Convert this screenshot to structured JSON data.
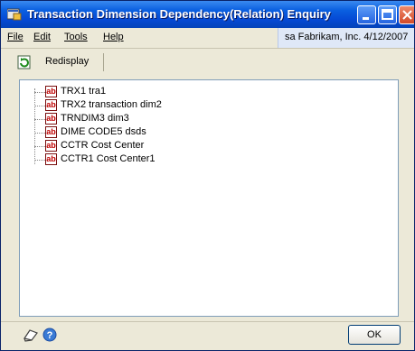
{
  "window": {
    "title": "Transaction Dimension Dependency(Relation) Enquiry"
  },
  "menu": {
    "file": "File",
    "edit": "Edit",
    "tools": "Tools",
    "help": "Help"
  },
  "context": {
    "text": "sa  Fabrikam, Inc.  4/12/2007"
  },
  "toolbar": {
    "redisplay_label": "Redisplay"
  },
  "tree": {
    "items": [
      {
        "code": "TRX1",
        "desc": "tra1",
        "label": "TRX1  tra1"
      },
      {
        "code": "TRX2",
        "desc": "transaction dim2",
        "label": "TRX2  transaction dim2"
      },
      {
        "code": "TRNDIM3",
        "desc": "dim3",
        "label": "TRNDIM3  dim3"
      },
      {
        "code": "DIME CODE5",
        "desc": "dsds",
        "label": "DIME CODE5  dsds"
      },
      {
        "code": "CCTR",
        "desc": "Cost Center",
        "label": "CCTR  Cost Center"
      },
      {
        "code": "CCTR1",
        "desc": "Cost Center1",
        "label": "CCTR1  Cost Center1"
      }
    ],
    "item_icon": "ab"
  },
  "buttons": {
    "ok_label": "OK"
  },
  "icons": {
    "app": "app-window-icon",
    "redisplay": "redisplay-icon",
    "note": "note-icon",
    "help": "help-icon"
  },
  "colors": {
    "title_bar": "#0549d4",
    "tree_border": "#7f9db9",
    "icon_red": "#c00000"
  }
}
